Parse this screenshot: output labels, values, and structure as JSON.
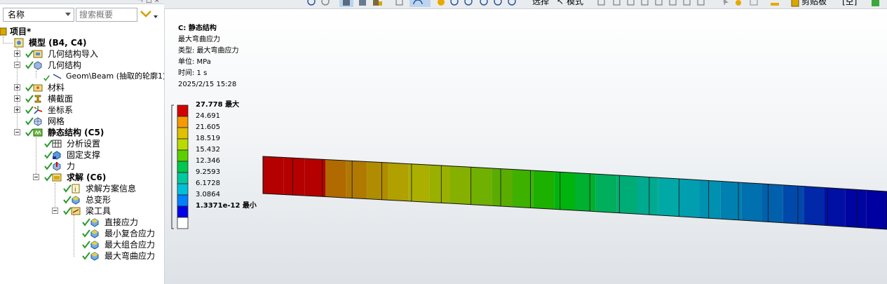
{
  "panel": {
    "filter_field": "名称",
    "search_placeholder": "搜索概要"
  },
  "tree": {
    "project": "项目*",
    "model": "模型 (B4, C4)",
    "geometry_import": "几何结构导入",
    "geometry": "几何结构",
    "beam": "Geom\\Beam (抽取的轮廓1)",
    "materials": "材料",
    "cross_sections": "横截面",
    "coordinate_systems": "坐标系",
    "mesh": "网格",
    "static_structural": "静态结构 (C5)",
    "analysis_settings": "分析设置",
    "fixed_support": "固定支撑",
    "force": "力",
    "solution": "求解 (C6)",
    "solution_information": "求解方案信息",
    "total_deformation": "总变形",
    "beam_tool": "梁工具",
    "direct_stress": "直接应力",
    "min_combined_stress": "最小复合应力",
    "max_combined_stress": "最大组合应力",
    "max_bending_stress": "最大弯曲应力"
  },
  "toolbar": {
    "select_label": "选择",
    "mode_label": "模式",
    "clipboard_label": "剪贴板",
    "empty_label": "[空]"
  },
  "result_info": {
    "title": "C: 静态结构",
    "name": "最大弯曲应力",
    "type": "类型: 最大弯曲应力",
    "unit": "单位: MPa",
    "time": "时间: 1 s",
    "date": "2025/2/15 15:28"
  },
  "legend": {
    "max_label": "27.778 最大",
    "min_label": "1.3371e-12 最小",
    "values": [
      "24.691",
      "21.605",
      "18.519",
      "15.432",
      "12.346",
      "9.2593",
      "6.1728",
      "3.0864"
    ],
    "colors": [
      "#d40000",
      "#f59a00",
      "#e0c000",
      "#b8dc00",
      "#5cd000",
      "#00c84c",
      "#00c8a0",
      "#00c0d8",
      "#0080ff",
      "#0000e8",
      "#ffffff"
    ]
  },
  "beam": {
    "segment_colors": [
      "#b50000",
      "#b50000",
      "#b50000",
      "#b06a00",
      "#b07a00",
      "#b08c00",
      "#b0a000",
      "#abb000",
      "#9ab000",
      "#86b000",
      "#70b000",
      "#5aac00",
      "#3eb000",
      "#1cb000",
      "#00b410",
      "#00b030",
      "#00ae5c",
      "#00ac76",
      "#00aa90",
      "#00a8a6",
      "#009eae",
      "#0090b0",
      "#0080b0",
      "#0070ae",
      "#0060ac",
      "#0048aa",
      "#0028a8",
      "#0010a4",
      "#0004a0",
      "#0000a0"
    ]
  }
}
